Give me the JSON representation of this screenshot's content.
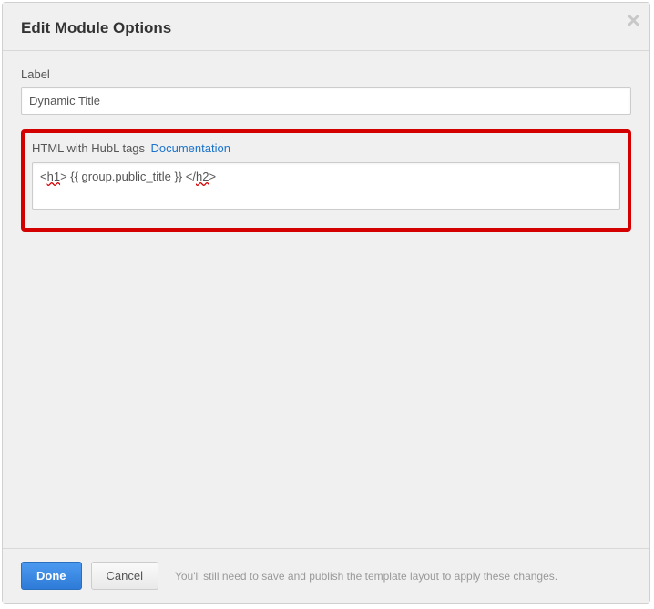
{
  "header": {
    "title": "Edit Module Options"
  },
  "fields": {
    "label_field_label": "Label",
    "label_field_value": "Dynamic Title",
    "html_field_label": "HTML with HubL tags",
    "documentation_link": "Documentation",
    "html_code_prefix": "<",
    "html_code_tag1": "h1",
    "html_code_mid": "> {{ group.public_title }} </",
    "html_code_tag2": "h2",
    "html_code_suffix": ">"
  },
  "footer": {
    "done_label": "Done",
    "cancel_label": "Cancel",
    "hint": "You'll still need to save and publish the template layout to apply these changes."
  }
}
